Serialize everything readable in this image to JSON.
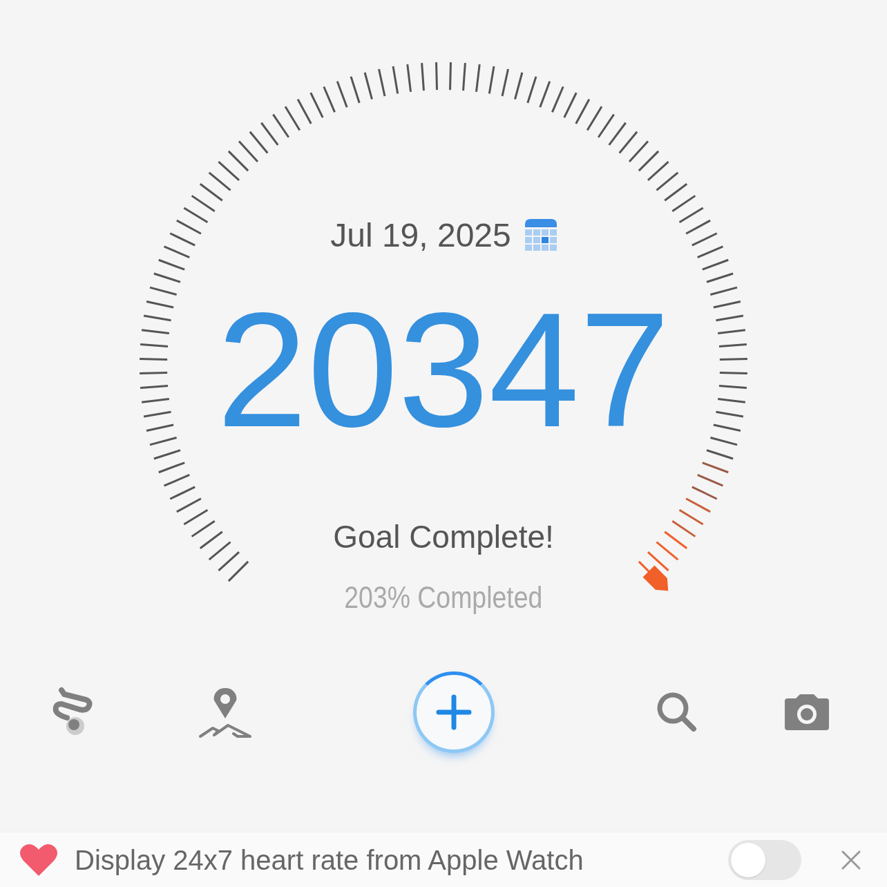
{
  "date": "Jul 19, 2025",
  "steps": "20347",
  "goal_status": "Goal Complete!",
  "progress_text": "203% Completed",
  "toolbar": [
    {
      "kind": "route"
    },
    {
      "kind": "map"
    },
    {
      "kind": "add"
    },
    {
      "kind": "search"
    },
    {
      "kind": "camera"
    }
  ],
  "banner": {
    "text": "Display 24x7 heart rate from Apple Watch",
    "on": false
  }
}
